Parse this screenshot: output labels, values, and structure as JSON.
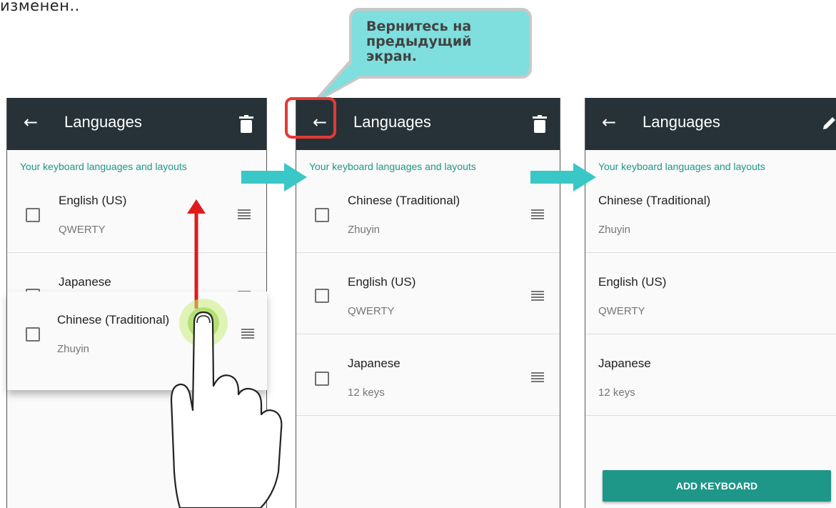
{
  "top_text": "изменен..",
  "callout": {
    "text": "Вернитесь на\nпредыдущий\nэкран."
  },
  "colors": {
    "toolbar": "#263238",
    "accent": "#1e9688",
    "callout": "#7fdede",
    "highlight": "#e53935",
    "arrow": "#39c7c7"
  },
  "panel1": {
    "title": "Languages",
    "back_icon": "arrow-left-icon",
    "action_icon": "trash-icon",
    "section": "Your keyboard languages and layouts",
    "rows": [
      {
        "name": "English (US)",
        "sub": "QWERTY"
      },
      {
        "name": "Japanese",
        "sub": ""
      }
    ],
    "dragging": {
      "name": "Chinese (Traditional)",
      "sub": "Zhuyin"
    }
  },
  "panel2": {
    "title": "Languages",
    "back_icon": "arrow-left-icon",
    "action_icon": "trash-icon",
    "section": "Your keyboard languages and layouts",
    "rows": [
      {
        "name": "Chinese (Traditional)",
        "sub": "Zhuyin"
      },
      {
        "name": "English (US)",
        "sub": "QWERTY"
      },
      {
        "name": "Japanese",
        "sub": "12 keys"
      }
    ]
  },
  "panel3": {
    "title": "Languages",
    "back_icon": "arrow-left-icon",
    "action_icon": "pencil-icon",
    "section": "Your keyboard languages and layouts",
    "rows": [
      {
        "name": "Chinese (Traditional)",
        "sub": "Zhuyin"
      },
      {
        "name": "English (US)",
        "sub": "QWERTY"
      },
      {
        "name": "Japanese",
        "sub": "12 keys"
      }
    ],
    "add_button": "ADD KEYBOARD"
  }
}
